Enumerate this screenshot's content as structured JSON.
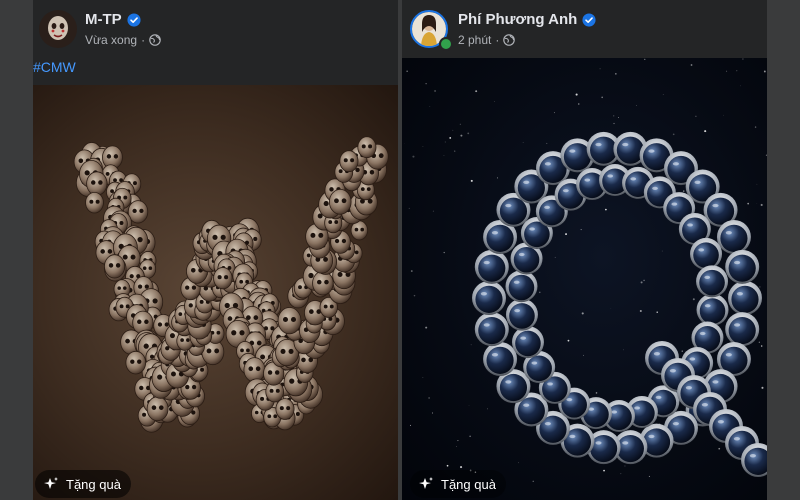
{
  "posts": [
    {
      "author": "M-TP",
      "timestamp": "Vừa xong",
      "caption": "#CMW",
      "verified": true,
      "privacy_icon": "globe-icon",
      "gift_label": "Tặng quà",
      "image_subject": "letter W formed by clustered skull-like masks on a brown background"
    },
    {
      "author": "Phí Phương Anh",
      "timestamp": "2 phút",
      "verified": true,
      "online": true,
      "privacy_icon": "globe-icon",
      "gift_label": "Tặng quà",
      "image_subject": "letter Q formed by astronaut helmets against a starry space background"
    }
  ],
  "colors": {
    "page_bg": "#3a3b3c",
    "card_bg": "#242526",
    "primary_text": "#e4e6eb",
    "secondary_text": "#b0b3b8",
    "hashtag": "#4599ff",
    "verified_badge": "#1b74e4",
    "online": "#31a24c"
  }
}
